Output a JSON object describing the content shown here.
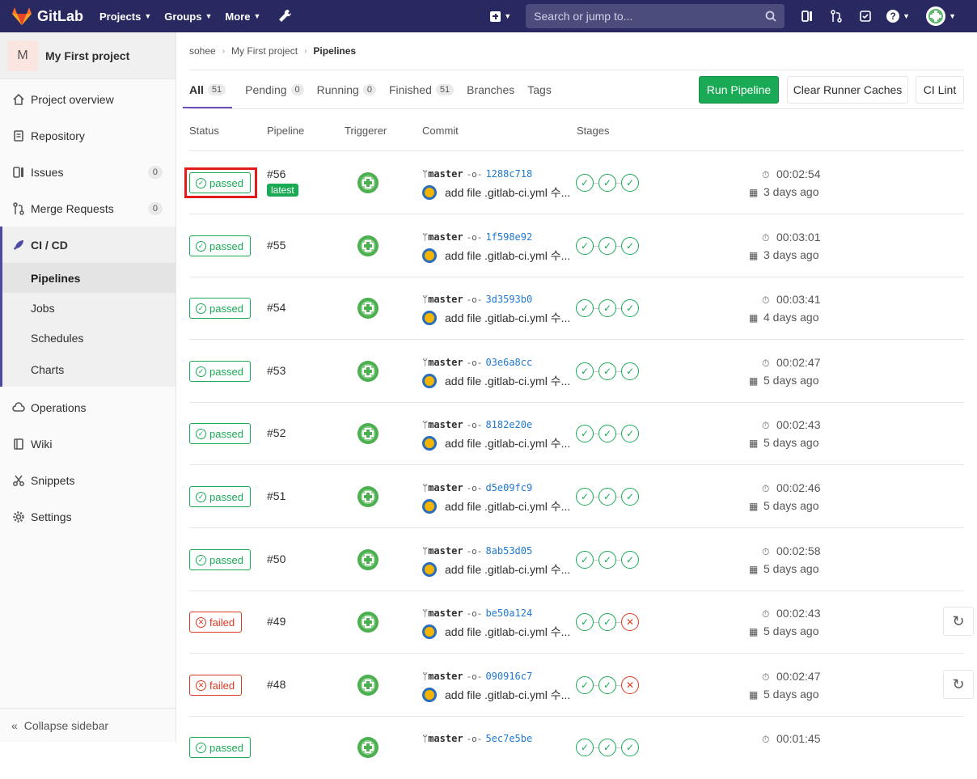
{
  "nav": {
    "brand": "GitLab",
    "projects": "Projects",
    "groups": "Groups",
    "more": "More",
    "search_placeholder": "Search or jump to..."
  },
  "sidebar": {
    "project_initial": "M",
    "project_name": "My First project",
    "items": [
      {
        "label": "Project overview",
        "icon": "home-icon"
      },
      {
        "label": "Repository",
        "icon": "doc-icon"
      },
      {
        "label": "Issues",
        "icon": "issues-icon",
        "count": "0"
      },
      {
        "label": "Merge Requests",
        "icon": "merge-icon",
        "count": "0"
      },
      {
        "label": "CI / CD",
        "icon": "rocket-icon"
      }
    ],
    "cicd_sub": [
      "Pipelines",
      "Jobs",
      "Schedules",
      "Charts"
    ],
    "items_after": [
      {
        "label": "Operations",
        "icon": "cloud-icon"
      },
      {
        "label": "Wiki",
        "icon": "book-icon"
      },
      {
        "label": "Snippets",
        "icon": "scissors-icon"
      },
      {
        "label": "Settings",
        "icon": "gear-icon"
      }
    ],
    "collapse": "Collapse sidebar"
  },
  "breadcrumb": [
    "sohee",
    "My First project",
    "Pipelines"
  ],
  "tabs": [
    {
      "label": "All",
      "count": "51"
    },
    {
      "label": "Pending",
      "count": "0"
    },
    {
      "label": "Running",
      "count": "0"
    },
    {
      "label": "Finished",
      "count": "51"
    },
    {
      "label": "Branches"
    },
    {
      "label": "Tags"
    }
  ],
  "buttons": {
    "run": "Run Pipeline",
    "clear": "Clear Runner Caches",
    "lint": "CI Lint"
  },
  "columns": [
    "Status",
    "Pipeline",
    "Triggerer",
    "Commit",
    "Stages"
  ],
  "colors": {
    "passed": "#1aaa55",
    "failed": "#db3b21",
    "nav": "#292961"
  },
  "latest_label": "latest",
  "pipelines": [
    {
      "status": "passed",
      "id": "#56",
      "branch": "master",
      "sha": "1288c718",
      "msg": "add file .gitlab-ci.yml 수...",
      "stages": [
        "ok",
        "ok",
        "ok"
      ],
      "duration": "00:02:54",
      "ago": "3 days ago",
      "latest": true
    },
    {
      "status": "passed",
      "id": "#55",
      "branch": "master",
      "sha": "1f598e92",
      "msg": "add file .gitlab-ci.yml 수...",
      "stages": [
        "ok",
        "ok",
        "ok"
      ],
      "duration": "00:03:01",
      "ago": "3 days ago"
    },
    {
      "status": "passed",
      "id": "#54",
      "branch": "master",
      "sha": "3d3593b0",
      "msg": "add file .gitlab-ci.yml 수...",
      "stages": [
        "ok",
        "ok",
        "ok"
      ],
      "duration": "00:03:41",
      "ago": "4 days ago"
    },
    {
      "status": "passed",
      "id": "#53",
      "branch": "master",
      "sha": "03e6a8cc",
      "msg": "add file .gitlab-ci.yml 수...",
      "stages": [
        "ok",
        "ok",
        "ok"
      ],
      "duration": "00:02:47",
      "ago": "5 days ago"
    },
    {
      "status": "passed",
      "id": "#52",
      "branch": "master",
      "sha": "8182e20e",
      "msg": "add file .gitlab-ci.yml 수...",
      "stages": [
        "ok",
        "ok",
        "ok"
      ],
      "duration": "00:02:43",
      "ago": "5 days ago"
    },
    {
      "status": "passed",
      "id": "#51",
      "branch": "master",
      "sha": "d5e09fc9",
      "msg": "add file .gitlab-ci.yml 수...",
      "stages": [
        "ok",
        "ok",
        "ok"
      ],
      "duration": "00:02:46",
      "ago": "5 days ago"
    },
    {
      "status": "passed",
      "id": "#50",
      "branch": "master",
      "sha": "8ab53d05",
      "msg": "add file .gitlab-ci.yml 수...",
      "stages": [
        "ok",
        "ok",
        "ok"
      ],
      "duration": "00:02:58",
      "ago": "5 days ago"
    },
    {
      "status": "failed",
      "id": "#49",
      "branch": "master",
      "sha": "be50a124",
      "msg": "add file .gitlab-ci.yml 수...",
      "stages": [
        "ok",
        "ok",
        "fail"
      ],
      "duration": "00:02:43",
      "ago": "5 days ago",
      "retry": true
    },
    {
      "status": "failed",
      "id": "#48",
      "branch": "master",
      "sha": "090916c7",
      "msg": "add file .gitlab-ci.yml 수...",
      "stages": [
        "ok",
        "ok",
        "fail"
      ],
      "duration": "00:02:47",
      "ago": "5 days ago",
      "retry": true
    },
    {
      "status": "passed",
      "id": "",
      "branch": "master",
      "sha": "5ec7e5be",
      "msg": "",
      "stages": [
        "ok",
        "ok",
        "ok"
      ],
      "duration": "00:01:45",
      "ago": ""
    }
  ]
}
